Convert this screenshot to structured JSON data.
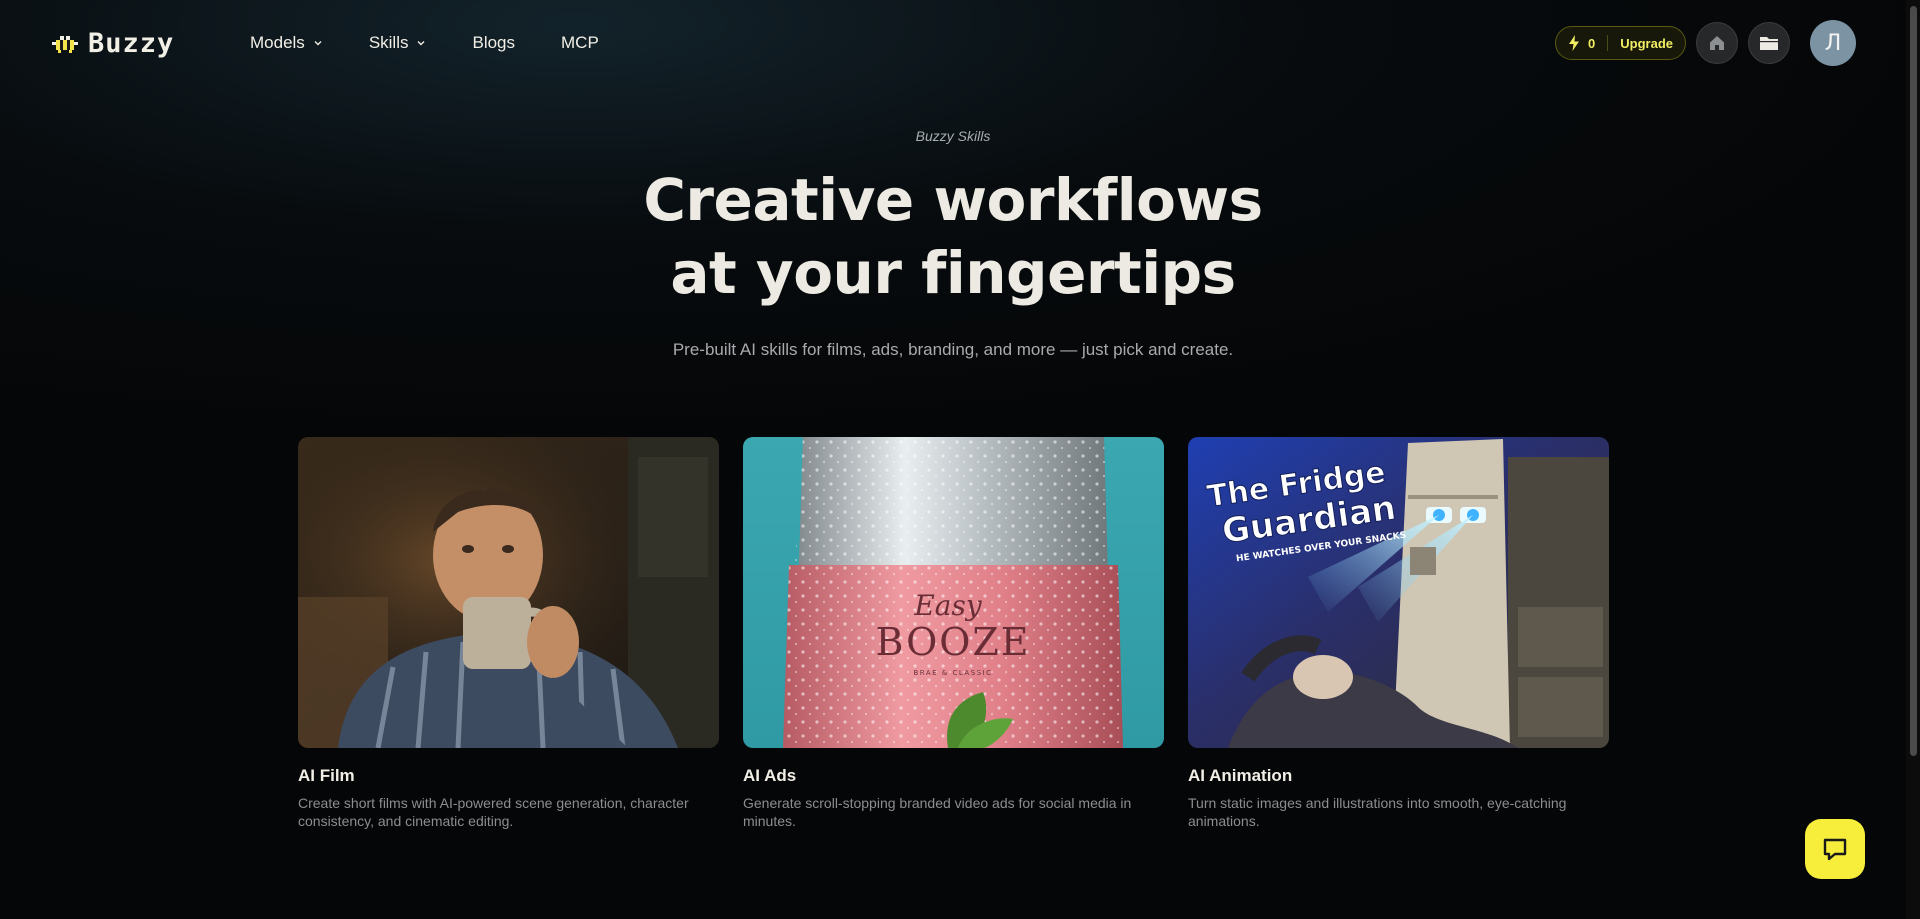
{
  "brand": {
    "name": "Buzzy"
  },
  "nav": {
    "items": [
      {
        "label": "Models",
        "has_dropdown": true
      },
      {
        "label": "Skills",
        "has_dropdown": true
      },
      {
        "label": "Blogs",
        "has_dropdown": false
      },
      {
        "label": "MCP",
        "has_dropdown": false
      }
    ]
  },
  "header_right": {
    "credits": "0",
    "upgrade_label": "Upgrade",
    "home_icon": "home-icon",
    "folder_icon": "folder-icon",
    "avatar_initial": "Л"
  },
  "hero": {
    "eyebrow": "Buzzy Skills",
    "headline_line1": "Creative workflows",
    "headline_line2": "at your fingertips",
    "subhead": "Pre-built AI skills for films, ads, branding, and more — just pick and create."
  },
  "cards": [
    {
      "title": "AI Film",
      "description": "Create short films with AI-powered scene generation, character consistency, and cinematic editing."
    },
    {
      "title": "AI Ads",
      "description": "Generate scroll-stopping branded video ads for social media in minutes.",
      "image_text": {
        "script": "Easy",
        "brand": "BOOZE",
        "tagline": "BRAE & CLASSIC"
      }
    },
    {
      "title": "AI Animation",
      "description": "Turn static images and illustrations into smooth, eye-catching animations.",
      "image_text": {
        "line1": "The Fridge",
        "line2": "Guardian",
        "tagline": "HE WATCHES OVER YOUR SNACKS"
      }
    }
  ],
  "colors": {
    "accent_yellow": "#f6ee3b",
    "background": "#050607",
    "text_primary": "#eceae2",
    "text_muted": "#8b8e91"
  }
}
